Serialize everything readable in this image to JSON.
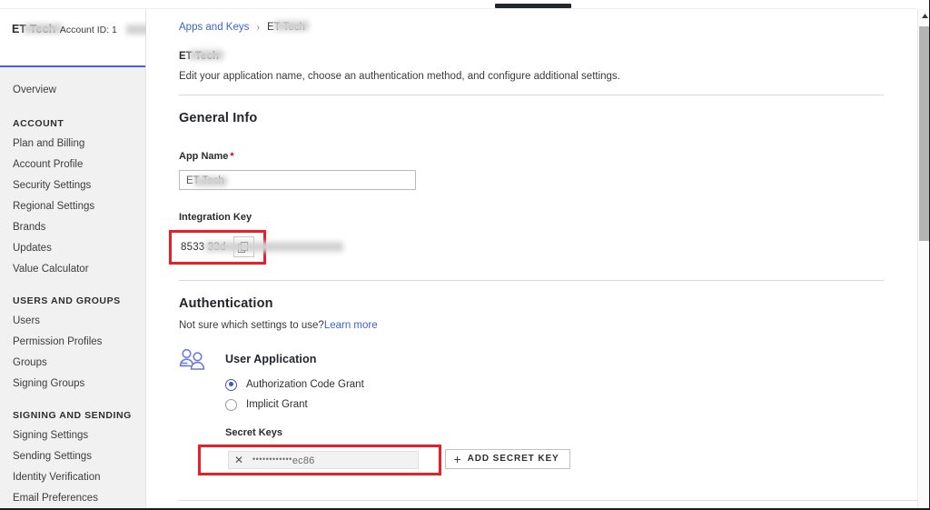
{
  "window": {
    "scroll_up_icon": "triangle-up-icon"
  },
  "sidebar": {
    "account_name": "ET Tech",
    "account_id_label": "Account ID: 1",
    "overview_label": "Overview",
    "groups": [
      {
        "heading": "ACCOUNT",
        "items": [
          "Plan and Billing",
          "Account Profile",
          "Security Settings",
          "Regional Settings",
          "Brands",
          "Updates",
          "Value Calculator"
        ]
      },
      {
        "heading": "USERS AND GROUPS",
        "items": [
          "Users",
          "Permission Profiles",
          "Groups",
          "Signing Groups"
        ]
      },
      {
        "heading": "SIGNING AND SENDING",
        "items": [
          "Signing Settings",
          "Sending Settings",
          "Identity Verification",
          "Email Preferences"
        ]
      }
    ]
  },
  "breadcrumb": {
    "root_label": "Apps and Keys",
    "separator": "›",
    "current_label": "ET Tech"
  },
  "header": {
    "title": "ET Tech",
    "description": "Edit your application name, choose an authentication method, and configure additional settings."
  },
  "general_info": {
    "section_title": "General Info",
    "app_name_label": "App Name",
    "required_marker": "*",
    "app_name_value": "ET Tech",
    "integration_key_label": "Integration Key",
    "integration_key_value": "8533        33d",
    "copy_icon": "copy-icon"
  },
  "authentication": {
    "section_title": "Authentication",
    "help_text": "Not sure which settings to use?",
    "help_link_label": "Learn more",
    "people_icon": "users-icon",
    "app_type_label": "User Application",
    "grant_options": [
      {
        "label": "Authorization Code Grant",
        "selected": true
      },
      {
        "label": "Implicit Grant",
        "selected": false
      }
    ],
    "secret_keys_label": "Secret Keys",
    "secret_key_masked_dots": "••••••••••••",
    "secret_key_suffix": "ec86",
    "remove_secret_icon": "close-x-icon",
    "add_secret_key_label": "ADD SECRET KEY",
    "add_icon": "plus-icon"
  },
  "colors": {
    "link": "#3a63d8",
    "accent_bar": "#4a5ce0",
    "highlight_box": "#ee1c25",
    "radio_selected": "#3f51d4",
    "required_star": "#d0021b"
  }
}
